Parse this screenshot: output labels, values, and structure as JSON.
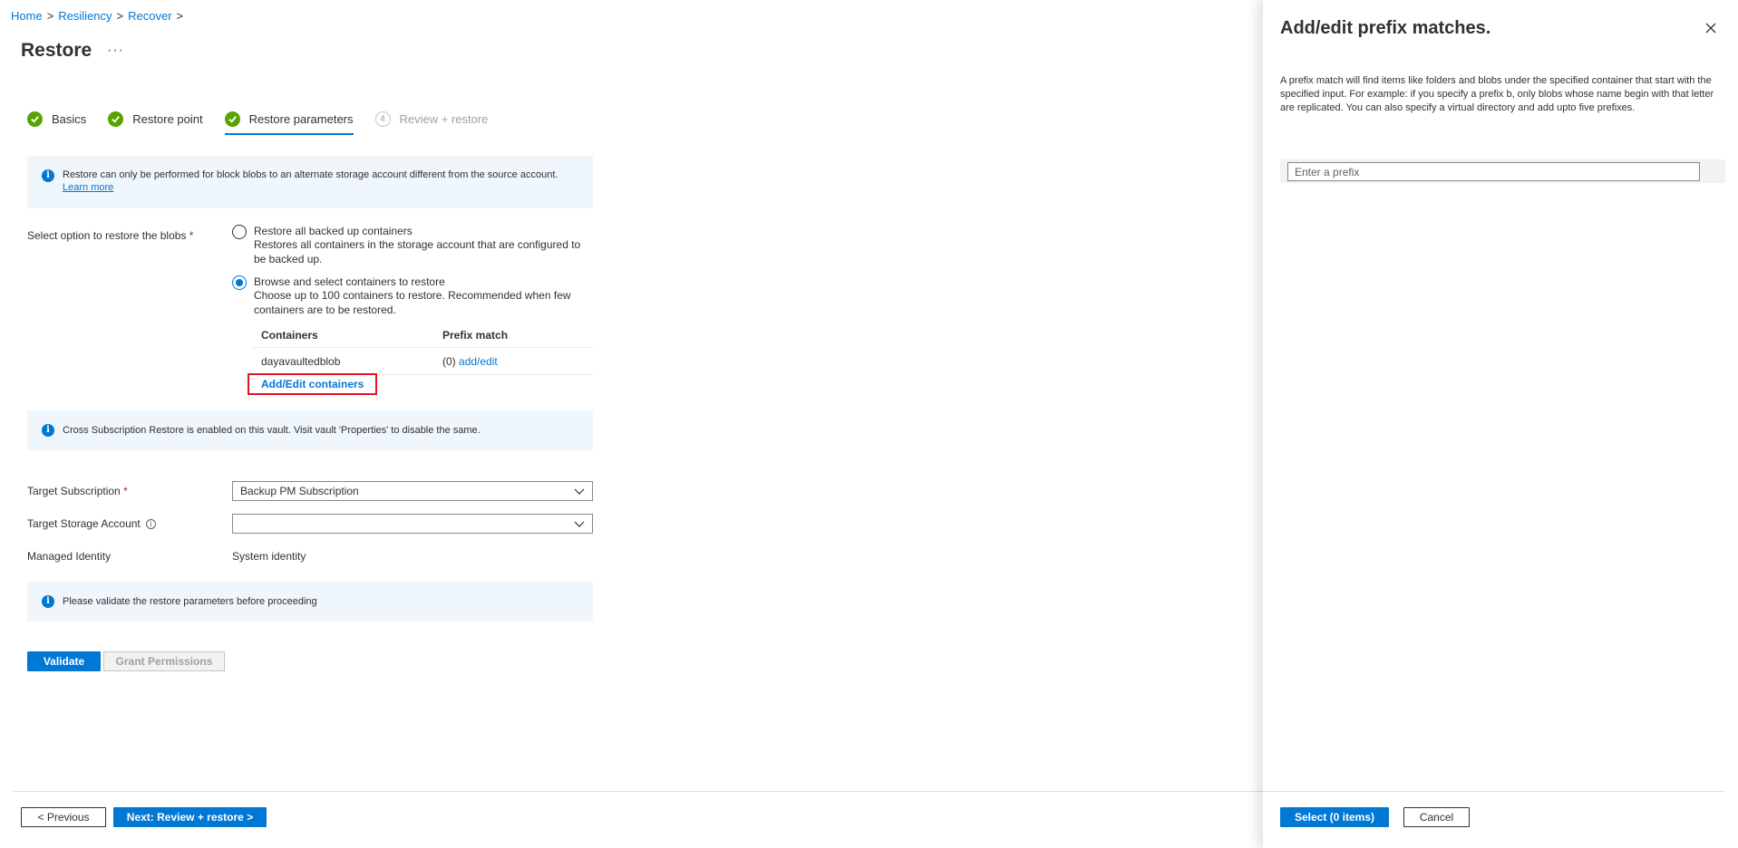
{
  "breadcrumb": {
    "items": [
      "Home",
      "Resiliency",
      "Recover"
    ],
    "separator": ">"
  },
  "page": {
    "title": "Restore",
    "more": "···"
  },
  "steps": [
    {
      "label": "Basics",
      "state": "done"
    },
    {
      "label": "Restore point",
      "state": "done"
    },
    {
      "label": "Restore parameters",
      "state": "active"
    },
    {
      "label": "Review + restore",
      "state": "disabled",
      "number": "4"
    }
  ],
  "banner1": {
    "text": "Restore can only be performed for block blobs to an alternate storage account different from the source account.",
    "link": "Learn more"
  },
  "restore_option": {
    "label": "Select option to restore the blobs",
    "required": "*",
    "options": [
      {
        "title": "Restore all backed up containers",
        "desc": "Restores all containers in the storage account that are configured to be backed up.",
        "selected": false
      },
      {
        "title": "Browse and select containers to restore",
        "desc": "Choose up to 100 containers to restore. Recommended when few containers are to be restored.",
        "selected": true
      }
    ]
  },
  "containers_table": {
    "headers": [
      "Containers",
      "Prefix match"
    ],
    "rows": [
      {
        "container": "dayavaultedblob",
        "count": "(0)",
        "action": "add/edit"
      }
    ],
    "add_edit": "Add/Edit containers"
  },
  "banner2": {
    "text": "Cross Subscription Restore is enabled on this vault. Visit vault 'Properties' to disable the same."
  },
  "target_subscription": {
    "label": "Target Subscription",
    "required": "*",
    "value": "Backup PM Subscription"
  },
  "target_storage": {
    "label": "Target Storage Account",
    "value": ""
  },
  "managed_identity": {
    "label": "Managed Identity",
    "value": "System identity"
  },
  "banner3": {
    "text": "Please validate the restore parameters before proceeding"
  },
  "buttons": {
    "validate": "Validate",
    "grant": "Grant Permissions",
    "previous": "< Previous",
    "next": "Next: Review + restore >"
  },
  "panel": {
    "title": "Add/edit prefix matches.",
    "description": "A prefix match will find items like folders and blobs under the specified container that start with the specified input. For example: if you specify a prefix b, only blobs whose name begin with that letter are replicated. You can also specify a virtual directory and add upto five prefixes.",
    "input_placeholder": "Enter a prefix",
    "select_button": "Select (0 items)",
    "cancel_button": "Cancel"
  },
  "colors": {
    "accent": "#0078d4",
    "success": "#57a300",
    "highlight": "#e81123",
    "banner_bg": "#eff6fc"
  }
}
